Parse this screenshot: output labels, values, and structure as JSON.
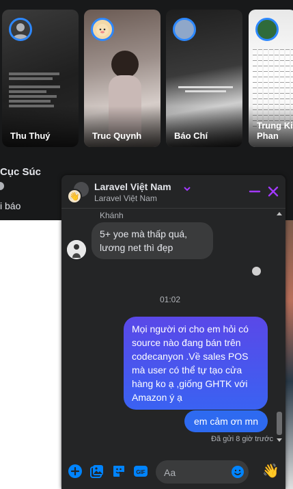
{
  "stories": [
    {
      "name": "Thu Thuý"
    },
    {
      "name": "Truc Quynh"
    },
    {
      "name": "Báo Chí"
    },
    {
      "name": "Trung Kiên Phan"
    }
  ],
  "feed": {
    "author": "Cục Súc",
    "text": "i báo"
  },
  "chat": {
    "title": "Laravel Việt Nam",
    "subtitle": "Laravel Việt Nam",
    "messages": {
      "sender": "Khánh",
      "incoming": "5+ yoe mà thấp quá, lương net thì đẹp",
      "time": "01:02",
      "outgoing_1": "Mọi người ơi cho em hỏi có source nào đang bán trên codecanyon .Về sales POS mà user có thể tự tạo cửa hàng ko ạ ,giống GHTK với Amazon ý ạ",
      "outgoing_2": "em cảm ơn mn",
      "status": "Đã gửi 8 giờ trước"
    },
    "composer": {
      "placeholder": "Aa",
      "wave_emoji": "👋"
    },
    "colors": {
      "accent": "#a239ff",
      "messenger_blue": "#0084ff",
      "bubble_gradient_top": "#5a48e8",
      "bubble_gradient_bottom": "#3a62f2"
    },
    "icons": [
      "minimize-icon",
      "close-icon",
      "plus-icon",
      "photo-icon",
      "sticker-icon",
      "gif-icon",
      "emoji-icon",
      "wave-emoji"
    ]
  }
}
